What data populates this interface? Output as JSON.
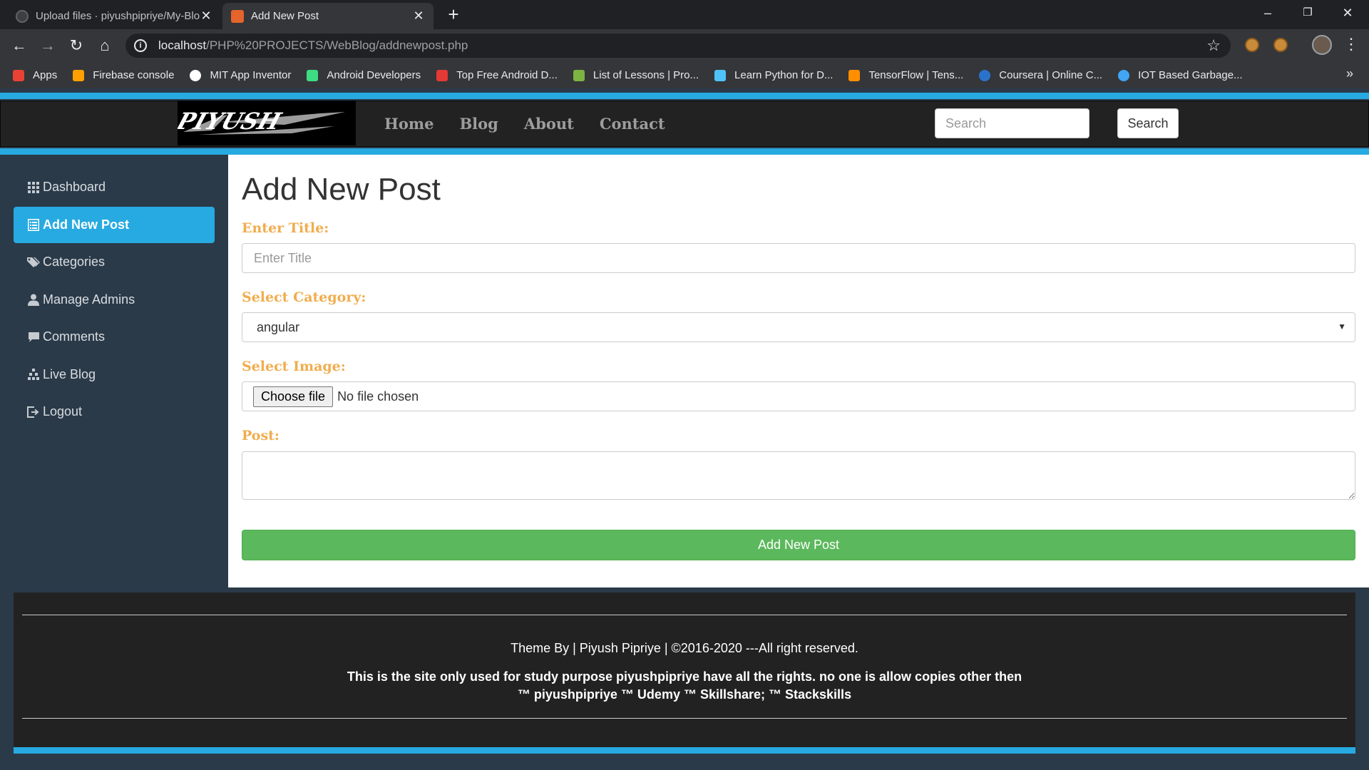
{
  "browser": {
    "tabs": [
      {
        "title": "Upload files · piyushpipriye/My-Blog",
        "active": false
      },
      {
        "title": "Add New Post",
        "active": true
      }
    ],
    "url_host": "localhost",
    "url_path": "/PHP%20PROJECTS/WebBlog/addnewpost.php",
    "bookmarks": [
      {
        "label": "Apps",
        "color": "#e94235"
      },
      {
        "label": "Firebase console",
        "color": "#ffa000"
      },
      {
        "label": "MIT App Inventor",
        "color": "#ffffff"
      },
      {
        "label": "Android Developers",
        "color": "#3ddc84"
      },
      {
        "label": "Top Free Android D...",
        "color": "#e53935"
      },
      {
        "label": "List of Lessons | Pro...",
        "color": "#7cb342"
      },
      {
        "label": "Learn Python for D...",
        "color": "#4fc3f7"
      },
      {
        "label": "TensorFlow  |  Tens...",
        "color": "#ff8f00"
      },
      {
        "label": "Coursera | Online C...",
        "color": "#2a73cc"
      },
      {
        "label": "IOT Based Garbage...",
        "color": "#42a5f5"
      }
    ]
  },
  "navbar": {
    "links": [
      "Home",
      "Blog",
      "About",
      "Contact"
    ],
    "search_placeholder": "Search",
    "search_button": "Search"
  },
  "sidebar": {
    "items": [
      {
        "label": "Dashboard",
        "icon": "dashboard-icon",
        "active": false
      },
      {
        "label": "Add New Post",
        "icon": "list-alt-icon",
        "active": true
      },
      {
        "label": "Categories",
        "icon": "tags-icon",
        "active": false
      },
      {
        "label": "Manage Admins",
        "icon": "user-icon",
        "active": false
      },
      {
        "label": "Comments",
        "icon": "comment-icon",
        "active": false
      },
      {
        "label": "Live Blog",
        "icon": "tree-icon",
        "active": false
      },
      {
        "label": "Logout",
        "icon": "logout-icon",
        "active": false
      }
    ]
  },
  "form": {
    "heading": "Add New Post",
    "title_label": "Enter Title:",
    "title_placeholder": "Enter Title",
    "category_label": "Select Category:",
    "category_value": "angular",
    "image_label": "Select Image:",
    "choose_file": "Choose file",
    "no_file": "No file chosen",
    "post_label": "Post:",
    "submit": "Add New Post"
  },
  "footer": {
    "credit": "Theme By | Piyush Pipriye | ©2016-2020 ---All right reserved.",
    "note_line1": "This is the site only used for study purpose piyushpipriye have all the rights. no one is allow copies other then",
    "note_line2": "™ piyushpipriye ™ Udemy ™ Skillshare; ™ Stackskills"
  },
  "colors": {
    "accent": "#27aae1",
    "label": "#f0ad4e",
    "success": "#5cb85c",
    "sidebar": "#2b3a49",
    "navbar": "#222222"
  }
}
